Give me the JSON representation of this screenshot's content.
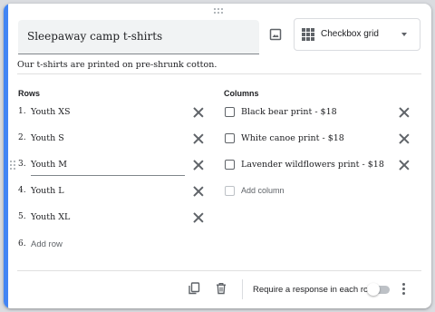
{
  "question": {
    "title": "Sleepaway camp t-shirts",
    "description": "Our t-shirts are printed on pre-shrunk cotton.",
    "type_label": "Checkbox grid"
  },
  "rows": {
    "heading": "Rows",
    "items": [
      {
        "num": "1.",
        "label": "Youth XS"
      },
      {
        "num": "2.",
        "label": "Youth S"
      },
      {
        "num": "3.",
        "label": "Youth M"
      },
      {
        "num": "4.",
        "label": "Youth L"
      },
      {
        "num": "5.",
        "label": "Youth XL"
      }
    ],
    "add": {
      "num": "6.",
      "label": "Add row"
    }
  },
  "columns": {
    "heading": "Columns",
    "items": [
      {
        "label": "Black bear print - $18"
      },
      {
        "label": "White canoe print - $18"
      },
      {
        "label": "Lavender wildflowers print - $18"
      }
    ],
    "add": {
      "label": "Add column"
    }
  },
  "footer": {
    "require_label": "Require a response in each row",
    "require_enabled": false
  },
  "colors": {
    "accent": "#4285f4",
    "icon": "#5f6368",
    "field_bg": "#f1f3f4"
  }
}
